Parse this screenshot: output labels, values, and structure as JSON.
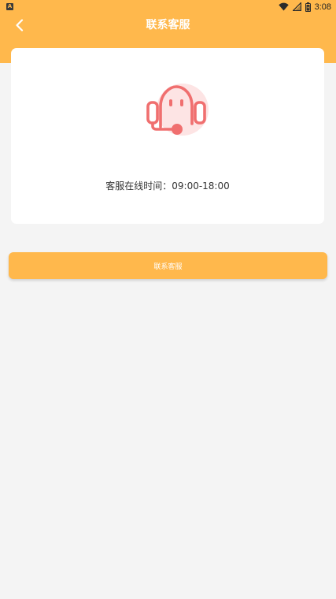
{
  "status_bar": {
    "app_icon_letter": "A",
    "time": "3:08",
    "icons": [
      "wifi-icon",
      "signal-icon",
      "battery-icon"
    ]
  },
  "header": {
    "title": "联系客服",
    "back_icon": "chevron-left-icon"
  },
  "card": {
    "illustration_icon": "headset-service-icon",
    "hours_text": "客服在线时间：09:00-18:00"
  },
  "contact_button": {
    "label": "联系客服"
  },
  "colors": {
    "accent": "#ffb84c",
    "background": "#f4f4f4",
    "card": "#ffffff",
    "illustration": "#f06f6f",
    "illustration_light": "#fde4e4"
  }
}
